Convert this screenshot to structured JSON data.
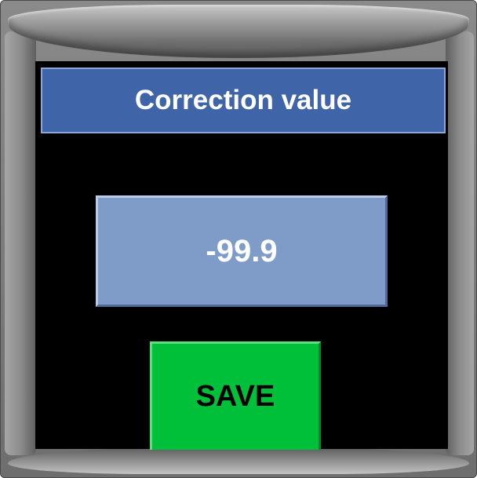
{
  "dialog": {
    "title": "Correction value",
    "value": "-99.9",
    "save_label": "SAVE"
  },
  "colors": {
    "title_bar": "#3f65a8",
    "value_field": "#7f9cc8",
    "save_button": "#00c03a",
    "screen_background": "#000000"
  }
}
